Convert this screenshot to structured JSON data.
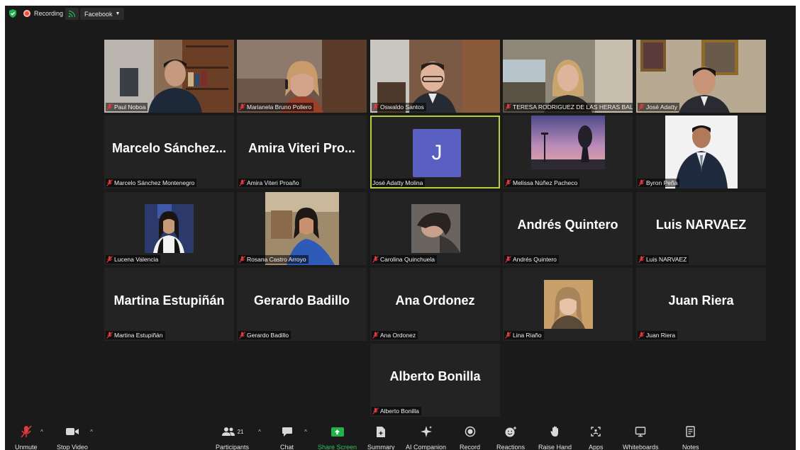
{
  "top_bar": {
    "recording_label": "Recording",
    "stream_label": "Facebook",
    "colors": {
      "recording_dot": "#f04b3a",
      "shield": "#22b14c"
    }
  },
  "tiles": [
    {
      "name": "Paul Noboa",
      "big_name": "",
      "type": "video",
      "muted": true
    },
    {
      "name": "Marianela Bruno Pollero",
      "big_name": "",
      "type": "video",
      "muted": true
    },
    {
      "name": "Oswaldo Santos",
      "big_name": "",
      "type": "video",
      "muted": true
    },
    {
      "name": "TERESA RODRIGUEZ DE LAS HERAS BAL...",
      "big_name": "",
      "type": "video",
      "muted": true
    },
    {
      "name": "José Adatty",
      "big_name": "",
      "type": "video",
      "muted": true
    },
    {
      "name": "Marcelo Sánchez Montenegro",
      "big_name": "Marcelo Sánchez...",
      "type": "name",
      "muted": true
    },
    {
      "name": "Amira Viteri Proaño",
      "big_name": "Amira Viteri Pro...",
      "type": "name",
      "muted": true
    },
    {
      "name": "José Adatty Molina",
      "big_name": "",
      "type": "avatar",
      "avatar_letter": "J",
      "active": true,
      "muted": false
    },
    {
      "name": "Melissa Núñez Pacheco",
      "big_name": "",
      "type": "photo",
      "muted": true
    },
    {
      "name": "Byron Peña",
      "big_name": "",
      "type": "photo",
      "muted": true
    },
    {
      "name": "Lucena Valencia",
      "big_name": "",
      "type": "photo",
      "muted": true
    },
    {
      "name": "Rosana Castro Arroyo",
      "big_name": "",
      "type": "photo",
      "muted": true
    },
    {
      "name": "Carolina Quinchuela",
      "big_name": "",
      "type": "photo",
      "muted": true
    },
    {
      "name": "Andrés Quintero",
      "big_name": "Andrés Quintero",
      "type": "name",
      "muted": true
    },
    {
      "name": "Luis NARVAEZ",
      "big_name": "Luis NARVAEZ",
      "type": "name",
      "muted": true
    },
    {
      "name": "Martina Estupiñán",
      "big_name": "Martina Estupiñán",
      "type": "name",
      "muted": true
    },
    {
      "name": "Gerardo Badillo",
      "big_name": "Gerardo Badillo",
      "type": "name",
      "muted": true
    },
    {
      "name": "Ana Ordonez",
      "big_name": "Ana Ordonez",
      "type": "name",
      "muted": true
    },
    {
      "name": "Lina Riaño",
      "big_name": "",
      "type": "photo",
      "muted": true
    },
    {
      "name": "Juan Riera",
      "big_name": "Juan Riera",
      "type": "name",
      "muted": true
    },
    {
      "name": "Alberto Bonilla",
      "big_name": "Alberto Bonilla",
      "type": "name",
      "muted": true
    }
  ],
  "toolbar": {
    "unmute": "Unmute",
    "stop_video": "Stop Video",
    "participants": "Participants",
    "participants_count": "21",
    "chat": "Chat",
    "share_screen": "Share Screen",
    "summary": "Summary",
    "ai_companion": "AI Companion",
    "record": "Record",
    "reactions": "Reactions",
    "raise_hand": "Raise Hand",
    "apps": "Apps",
    "whiteboards": "Whiteboards",
    "notes": "Notes",
    "colors": {
      "share_screen": "#22b14c",
      "muted_icon": "#e0393e",
      "active_speaker": "#b3d13a",
      "avatar_bg": "#5a5fc2"
    }
  }
}
